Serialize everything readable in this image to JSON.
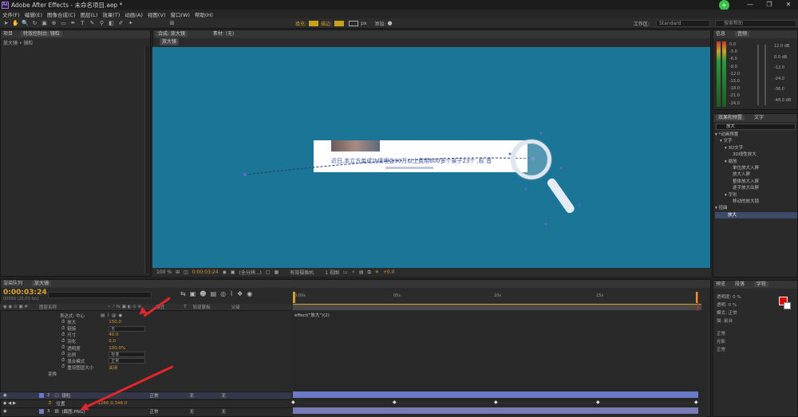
{
  "app": {
    "title": "Adobe After Effects - 未命名项目.aep *",
    "logo": "Ae",
    "window_controls": [
      "—",
      "❐",
      "✕"
    ],
    "badge": "+"
  },
  "menu": [
    "文件(F)",
    "编辑(E)",
    "图像合成(C)",
    "图层(L)",
    "效果(T)",
    "动画(A)",
    "视图(V)",
    "窗口(W)",
    "帮助(H)"
  ],
  "toolbar": {
    "fill_label": "填充:",
    "stroke_label": "描边:",
    "px_label": "px",
    "add_label": "添加:",
    "workspace_label": "工作区:",
    "workspace_value": "Standard",
    "help_placeholder": "搜索帮助"
  },
  "left_panel": {
    "tabs": [
      "项目",
      "特效控制台: 镜粒"
    ],
    "breadcrumb": "放大镜 • 镜粒"
  },
  "viewer": {
    "tabs": [
      "合成: 放大镜",
      "素材: (无)"
    ],
    "subtab": "放大镜",
    "zoom": "100 %",
    "time": "0:00:03:24",
    "resolution": "(全分辨...)",
    "camera": "有效摄像机",
    "views": "1 视图",
    "exposure": "+0.0",
    "content_text": "近日,本立方单成功填埋会90万以上费用600多个亲子23个 ,标 音"
  },
  "audio_panel": {
    "tabs": [
      "信息",
      "音频"
    ],
    "left_labels": [
      "0.0",
      "-3.0",
      "-6.0",
      "-9.0",
      "-12.0",
      "-15.0",
      "-18.0",
      "-21.0",
      "-24.0"
    ],
    "right_labels": [
      "12.0 dB",
      "0.0 dB",
      "-12.0",
      "-24.0",
      "-36.0",
      "-48.0 dB"
    ]
  },
  "effects_panel": {
    "tabs": [
      "效果和预置",
      "文字"
    ],
    "search_value": "放大",
    "items": [
      {
        "label": "▾ *动画预置",
        "indent": 0
      },
      {
        "label": "▾ 文字",
        "indent": 1
      },
      {
        "label": "▾ 3D文字",
        "indent": 2
      },
      {
        "label": "3D线性放大",
        "indent": 3
      },
      {
        "label": "▾ 缩放",
        "indent": 2
      },
      {
        "label": "单位放大入屏",
        "indent": 3
      },
      {
        "label": "放大入屏",
        "indent": 3
      },
      {
        "label": "整体放大入屏",
        "indent": 3
      },
      {
        "label": "逐字放大出屏",
        "indent": 3
      },
      {
        "label": "▾ 字形",
        "indent": 2
      },
      {
        "label": "移动的放大镜",
        "indent": 3
      },
      {
        "label": "▾ 扭曲",
        "indent": 0
      },
      {
        "label": "放大",
        "indent": 1,
        "selected": true
      }
    ]
  },
  "char_panel": {
    "tabs": [
      "预览",
      "段落",
      "字符"
    ],
    "labels": [
      "透明度: 0 %",
      "透明: 0 %",
      "模式: 正常",
      "描: 前台",
      "正常",
      "光影",
      "正常"
    ]
  },
  "timeline": {
    "tabs": [
      "渲染队列",
      "放大镜"
    ],
    "timecode": "0:00:03:24",
    "fps": "00099 (25.00 fps)",
    "header_cols": [
      "图层名称",
      "模式",
      "T",
      "轨道蒙板",
      "父级"
    ],
    "ruler": [
      "0:00s",
      "05s",
      "10s",
      "15s"
    ],
    "expression_label": "表达式: 中心",
    "expression_text": "effect(\"放大\")(2)",
    "properties": [
      {
        "name": "放大",
        "value": "150.0"
      },
      {
        "name": "链接",
        "value": "无",
        "dropdown": true
      },
      {
        "name": "尺寸",
        "value": "40.0"
      },
      {
        "name": "羽化",
        "value": "0.0"
      },
      {
        "name": "透明度",
        "value": "100.0%"
      },
      {
        "name": "比例",
        "value": "标准",
        "dropdown": true
      },
      {
        "name": "混合模式",
        "value": "正常",
        "dropdown": true
      },
      {
        "name": "重设图层大小",
        "value": "关闭"
      }
    ],
    "transform_label": "变换",
    "layers": [
      {
        "num": "2",
        "name": "镜粒",
        "mode": "正常",
        "track": "无",
        "parent": "无"
      },
      {
        "num": "",
        "name": "位置",
        "value": "1266.0,348.0"
      },
      {
        "num": "3",
        "name": "[截图.PNG]",
        "mode": "正常",
        "track": "无",
        "parent": "无"
      }
    ]
  },
  "colors": {
    "accent": "#d7a62c",
    "comp_bg": "#1a7596",
    "arrow": "#e3262b",
    "layer_bar": "#6a7ac8"
  }
}
